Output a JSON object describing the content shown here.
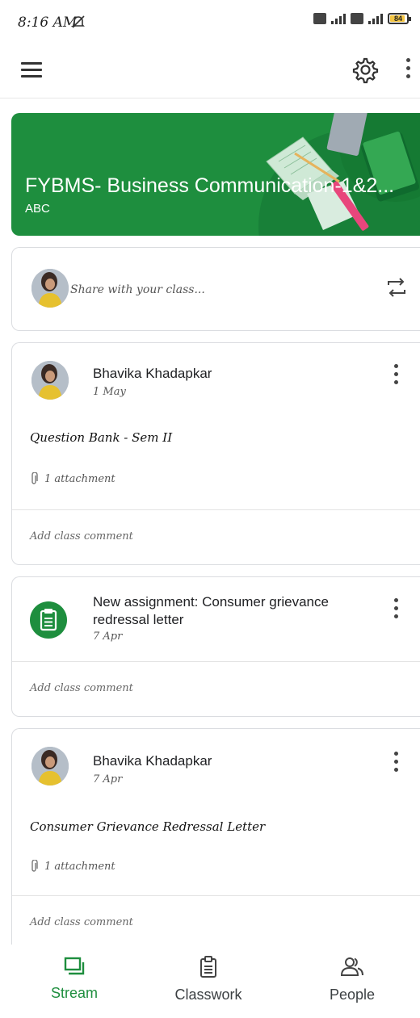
{
  "status_bar": {
    "time": "8:16 AM",
    "battery": "84"
  },
  "class_banner": {
    "title": "FYBMS- Business Communication-1&2...",
    "section": "ABC"
  },
  "share": {
    "placeholder": "Share with your class..."
  },
  "posts": [
    {
      "type": "material",
      "author": "Bhavika Khadapkar",
      "date": "1 May",
      "title": "Question Bank - Sem II",
      "attachments": "1 attachment",
      "comment_prompt": "Add class comment"
    },
    {
      "type": "assignment",
      "title": "New assignment: Consumer grievance redressal letter",
      "date": "7 Apr",
      "comment_prompt": "Add class comment"
    },
    {
      "type": "material",
      "author": "Bhavika Khadapkar",
      "date": "7 Apr",
      "title": "Consumer Grievance Redressal Letter",
      "attachments": "1 attachment",
      "comment_prompt": "Add class comment"
    }
  ],
  "bottom_nav": {
    "items": [
      {
        "label": "Stream",
        "icon": "stream-icon",
        "active": true
      },
      {
        "label": "Classwork",
        "icon": "classwork-icon",
        "active": false
      },
      {
        "label": "People",
        "icon": "people-icon",
        "active": false
      }
    ]
  },
  "colors": {
    "accent": "#1e8e3e"
  }
}
